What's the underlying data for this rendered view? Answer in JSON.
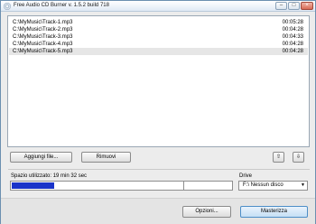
{
  "window": {
    "title": "Free Audio CD Burner  v. 1.5.2 build 718"
  },
  "title_controls": {
    "minimize": "–",
    "maximize": "□",
    "close": "×"
  },
  "tracks": [
    {
      "path": "C:\\MyMusic\\Track-1.mp3",
      "duration": "00:05:28"
    },
    {
      "path": "C:\\MyMusic\\Track-2.mp3",
      "duration": "00:04:28"
    },
    {
      "path": "C:\\MyMusic\\Track-3.mp3",
      "duration": "00:04:33"
    },
    {
      "path": "C:\\MyMusic\\Track-4.mp3",
      "duration": "00:04:28"
    },
    {
      "path": "C:\\MyMusic\\Track-5.mp3",
      "duration": "00:04:28"
    }
  ],
  "selected_track": 4,
  "buttons": {
    "add_files": "Aggiungi file...",
    "remove": "Rimuovi",
    "move_up": "⇧",
    "move_down": "⇩",
    "options": "Opzioni...",
    "burn": "Masterizza"
  },
  "space": {
    "label": "Spazio utilizzato:  19 min 32 sec",
    "used_fraction": 0.19,
    "capacity_mark_fraction": 0.78
  },
  "drive": {
    "label": "Drive",
    "selected": "F:\\ Nessun disco",
    "arrow": "▼"
  },
  "colors": {
    "progress": "#1a34c9",
    "accent_button": "#4d8ec7"
  }
}
